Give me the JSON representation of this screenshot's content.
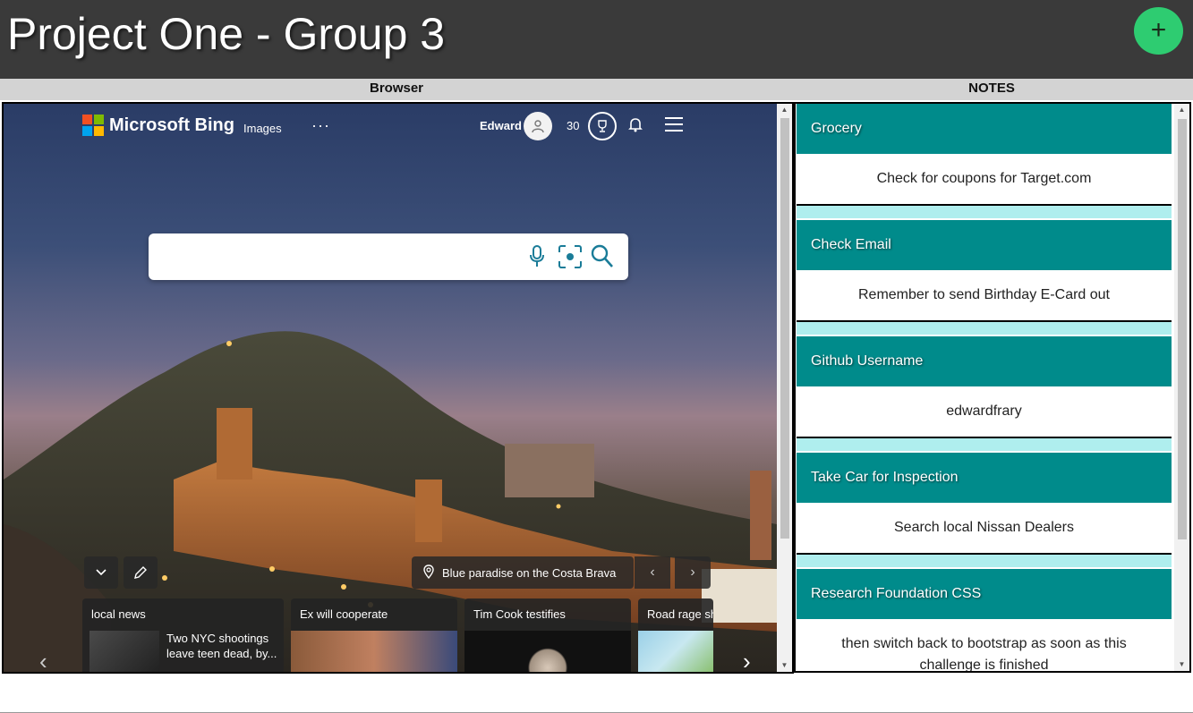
{
  "app": {
    "title": "Project One - Group 3",
    "add_label": "+"
  },
  "columns": {
    "browser": "Browser",
    "notes": "NOTES"
  },
  "bing": {
    "brand": "Microsoft Bing",
    "nav_images": "Images",
    "nav_more": "···",
    "user_name": "Edward",
    "points": "30",
    "search_placeholder": "",
    "image_caption": "Blue paradise on the Costa Brava",
    "news": [
      {
        "title": "local news",
        "snippet": "Two NYC shootings leave teen dead, by..."
      },
      {
        "title": "Ex will cooperate",
        "snippet": ""
      },
      {
        "title": "Tim Cook testifies",
        "snippet": ""
      },
      {
        "title": "Road rage sh",
        "snippet": ""
      }
    ]
  },
  "notes": [
    {
      "title": "Grocery",
      "body": "Check for coupons for Target.com"
    },
    {
      "title": "Check Email",
      "body": "Remember to send Birthday E-Card out"
    },
    {
      "title": "Github Username",
      "body": "edwardfrary"
    },
    {
      "title": "Take Car for Inspection",
      "body": "Search local Nissan Dealers"
    },
    {
      "title": "Research Foundation CSS",
      "body": "then switch back to bootstrap as soon as this challenge is finished"
    }
  ],
  "colors": {
    "note_header": "#008b8b",
    "note_gap": "#afeeee",
    "add_button": "#2ecc71",
    "topbar": "#3a3a3a"
  }
}
